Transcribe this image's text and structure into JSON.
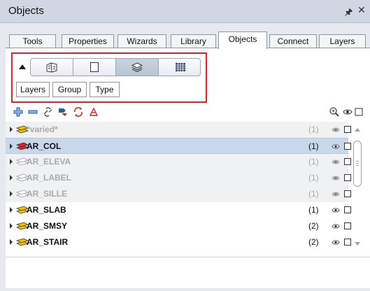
{
  "window": {
    "title": "Objects",
    "pin_glyph": "p",
    "close_glyph": "×"
  },
  "tabs": [
    {
      "label": "Tools",
      "active": false
    },
    {
      "label": "Properties",
      "active": false
    },
    {
      "label": "Wizards",
      "active": false
    },
    {
      "label": "Library",
      "active": false
    },
    {
      "label": "Objects",
      "active": true
    },
    {
      "label": "Connect",
      "active": false
    },
    {
      "label": "Layers",
      "active": false
    }
  ],
  "view_modes": [
    {
      "icon": "building-icon",
      "active": false
    },
    {
      "icon": "page-icon",
      "active": false
    },
    {
      "icon": "layers-stack-icon",
      "active": true
    },
    {
      "icon": "grid-icon",
      "active": false
    }
  ],
  "sort_buttons": [
    "Layers",
    "Group",
    "Type"
  ],
  "toolbar_icons": [
    "add-icon",
    "remove-icon",
    "link-icon",
    "move-icon",
    "refresh-icon",
    "delete-icon",
    "zoom-icon",
    "visibility-icon",
    "checkbox-icon"
  ],
  "layers": [
    {
      "name": "*varied*",
      "count": "(1)",
      "dim": true,
      "selected": false
    },
    {
      "name": "AR_COL",
      "count": "(1)",
      "dim": false,
      "selected": true
    },
    {
      "name": "AR_ELEVA",
      "count": "(1)",
      "dim": true,
      "selected": false
    },
    {
      "name": "AR_LABEL",
      "count": "(1)",
      "dim": true,
      "selected": false
    },
    {
      "name": "AR_SILLE",
      "count": "(1)",
      "dim": true,
      "selected": false
    },
    {
      "name": "AR_SLAB",
      "count": "(1)",
      "dim": false,
      "selected": false
    },
    {
      "name": "AR_SMSY",
      "count": "(2)",
      "dim": false,
      "selected": false
    },
    {
      "name": "AR_STAIR",
      "count": "(2)",
      "dim": false,
      "selected": false
    }
  ],
  "colors": {
    "accent_red": "#e0202a",
    "selected_row": "#c8d8ea",
    "icon_yellow": "#f2c200",
    "icon_red": "#e0202a"
  }
}
